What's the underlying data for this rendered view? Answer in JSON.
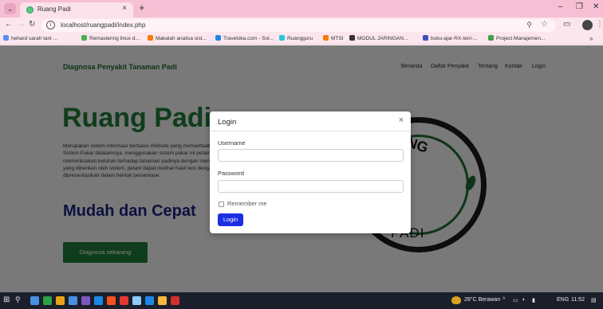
{
  "browser": {
    "tab_title": "Ruang Padi",
    "tab_close": "×",
    "new_tab": "+",
    "url": "localhost/ruangpadi/index.php",
    "minimize": "–",
    "restore": "❐",
    "close": "✕",
    "bookmarks": [
      {
        "label": "hehard sarah tani ...",
        "color": "#5b8def"
      },
      {
        "label": "Remastering linux d...",
        "color": "#4caf50"
      },
      {
        "label": "Makalah analisa sist...",
        "color": "#f57c00"
      },
      {
        "label": "Traveloka.com - Sol...",
        "color": "#1e88e5"
      },
      {
        "label": "Ruangguru",
        "color": "#26c6da"
      },
      {
        "label": "MTSI",
        "color": "#f57c00"
      },
      {
        "label": "MODUL JARINGAN...",
        "color": "#333333"
      },
      {
        "label": "buku-ajar-RX-teiri-...",
        "color": "#3f51b5"
      },
      {
        "label": "Project Manajemen...",
        "color": "#43a047"
      }
    ]
  },
  "page": {
    "brand": "Diagnosa Penyakit Tanaman Padi",
    "nav": [
      "Beranda",
      "Daftar Penyakit",
      "Tentang",
      "Kontak",
      "Login"
    ],
    "hero_title": "Ruang Padi",
    "hero_desc": "Merupakan sistem informasi berbasis Website yang memanfaatkan teknologi Sistem Pakar didalamnya. menggunakan sistem pakar ini petani dapat meng memeriksakan keluhan terhadap tanaman padinya dengan menjawab pertanyaan yang diberikan oleh sistem, petani dapat melihat hasil test dengan t dipresentasikan dalam bentuk persentase.",
    "subtitle": "Mudah dan Cepat",
    "cta": "Diagnosa sekarang",
    "logo_top": "ANG",
    "logo_bottom": "PADI"
  },
  "modal": {
    "title": "Login",
    "close": "×",
    "username_label": "Username",
    "username_value": "",
    "password_label": "Password",
    "password_value": "",
    "remember_label": "Remember me",
    "submit": "Login"
  },
  "taskbar": {
    "weather": "28°C Berawan",
    "lang": "ENG",
    "time": "11:52",
    "apps": [
      "#4a90e2",
      "#2ea043",
      "#e8a317",
      "#4a90e2",
      "#7e57c2",
      "#1e88e5",
      "#f4511e",
      "#e53935",
      "#90caf9",
      "#1e88e5",
      "#f6b73c",
      "#d32f2f"
    ]
  }
}
